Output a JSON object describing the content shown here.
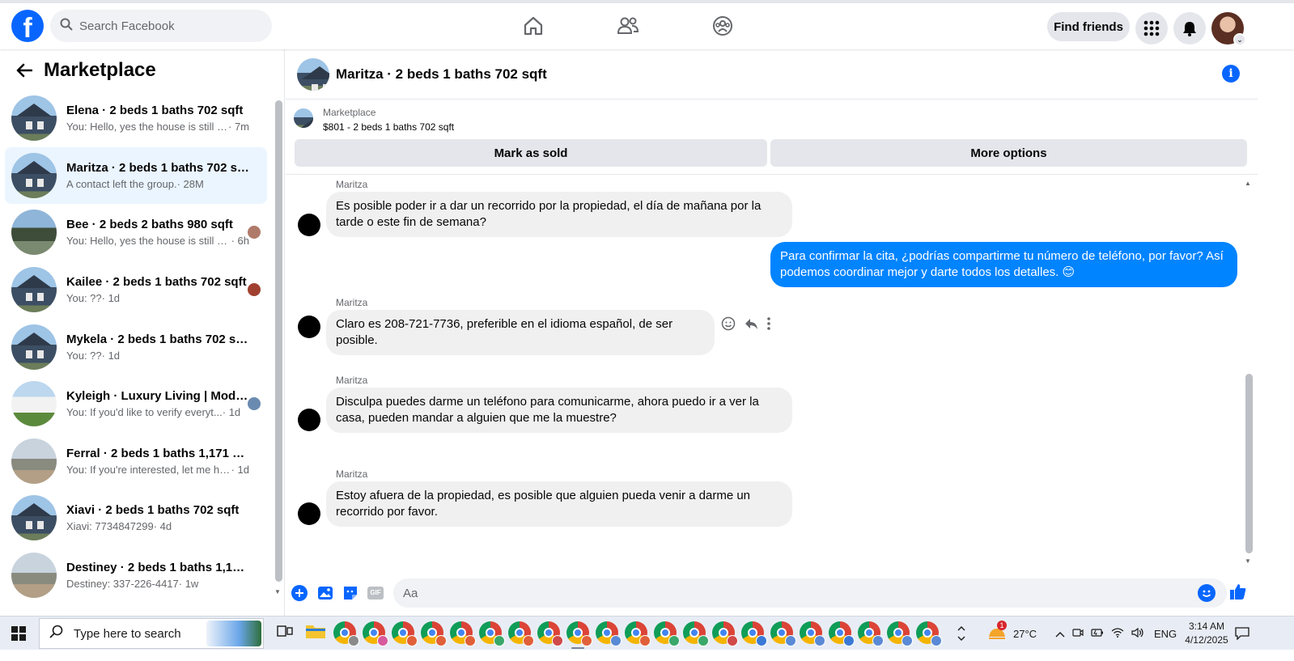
{
  "topbar": {
    "logo_letter": "f",
    "search_placeholder": "Search Facebook",
    "find_friends_label": "Find friends"
  },
  "sidebar": {
    "title": "Marketplace",
    "conversations": [
      {
        "title": "Elena · 2 beds 1 baths 702 sqft",
        "snippet": "You: Hello, yes the house is still av...",
        "time": " · 7m",
        "thumb": "house",
        "active": false
      },
      {
        "title": "Maritza · 2 beds 1 baths 702 sqft",
        "snippet": "A contact left the group.",
        "time": " · 28M",
        "thumb": "house",
        "active": true
      },
      {
        "title": "Bee · 2 beds 2 baths 980 sqft",
        "snippet": "You: Hello, yes the house is still a...",
        "time": " · 6h",
        "thumb": "house2",
        "active": false,
        "mini_color": "#b07a6a"
      },
      {
        "title": "Kailee · 2 beds 1 baths 702 sqft",
        "snippet": "You: ??",
        "time": " · 1d",
        "thumb": "house",
        "active": false,
        "mini_color": "#a04030"
      },
      {
        "title": "Mykela · 2 beds 1 baths 702 sqft",
        "snippet": "You: ??",
        "time": " · 1d",
        "thumb": "house",
        "active": false
      },
      {
        "title": "Kyleigh · Luxury Living | Mode...",
        "snippet": "You: If you'd like to verify everyt...",
        "time": " · 1d",
        "thumb": "house3",
        "active": false,
        "mini_color": "#6a8ab0"
      },
      {
        "title": "Ferral · 2 beds 1 baths 1,171 sqft",
        "snippet": "You: If you're interested, let me hav...",
        "time": " · 1d",
        "thumb": "house4",
        "active": false
      },
      {
        "title": "Xiavi · 2 beds 1 baths 702 sqft",
        "snippet": "Xiavi: 7734847299",
        "time": " · 4d",
        "thumb": "house",
        "active": false
      },
      {
        "title": "Destiney · 2 beds 1 baths 1,171 sqft",
        "snippet": "Destiney: 337-226-4417",
        "time": " · 1w",
        "thumb": "house4",
        "active": false
      }
    ]
  },
  "chat": {
    "header_title": "Maritza · 2 beds 1 baths 702 sqft",
    "listing": {
      "source": "Marketplace",
      "price_line": "$801 - 2 beds 1 baths 702 sqft",
      "mark_sold_label": "Mark as sold",
      "more_options_label": "More options"
    },
    "messages": [
      {
        "sender": "Maritza",
        "direction": "in",
        "text": "Es posible poder ir a dar un recorrido por la propiedad, el día de mañana por la tarde o este fin de semana?"
      },
      {
        "sender": "",
        "direction": "out",
        "text": "Para confirmar la cita, ¿podrías compartirme tu número de teléfono, por favor? Así podemos coordinar mejor y darte todos los detalles. 😊"
      },
      {
        "sender": "Maritza",
        "direction": "in",
        "text": "Claro es 208-721-7736, preferible en el idioma español, de ser posible."
      },
      {
        "sender": "Maritza",
        "direction": "in",
        "text": "Disculpa puedes darme un teléfono para comunicarme, ahora puedo ir a ver la casa, pueden mandar a alguien que me la muestre?"
      },
      {
        "sender": "Maritza",
        "direction": "in",
        "text": "Estoy afuera de la propiedad, es posible que alguien pueda venir a darme un recorrido por favor."
      }
    ],
    "composer_placeholder": "Aa",
    "gif_label": "GIF"
  },
  "taskbar": {
    "search_placeholder": "Type here to search",
    "weather_temp": "27°C",
    "weather_badge": "1",
    "language": "ENG",
    "time": "3:14 AM",
    "date": "4/12/2025",
    "app_badge_colors": [
      "#8a8a8a",
      "#d65a9c",
      "#e0603a",
      "#e0603a",
      "#e0603a",
      "#3aa86a",
      "#e0603a",
      "#d04a4a",
      "#e0603a",
      "#5a8ad6",
      "#e0603a",
      "#3aa86a",
      "#3aa86a",
      "#d04a4a",
      "#3a7ad6",
      "#5a8ad6",
      "#5a8ad6",
      "#3a7ad6",
      "#5a8ad6",
      "#5a8ad6",
      "#5a8ad6"
    ]
  },
  "colors": {
    "facebook_blue": "#0866ff",
    "outgoing_bubble": "#0084ff",
    "incoming_bubble": "#f0f0f0",
    "active_conversation": "#ebf5ff"
  }
}
